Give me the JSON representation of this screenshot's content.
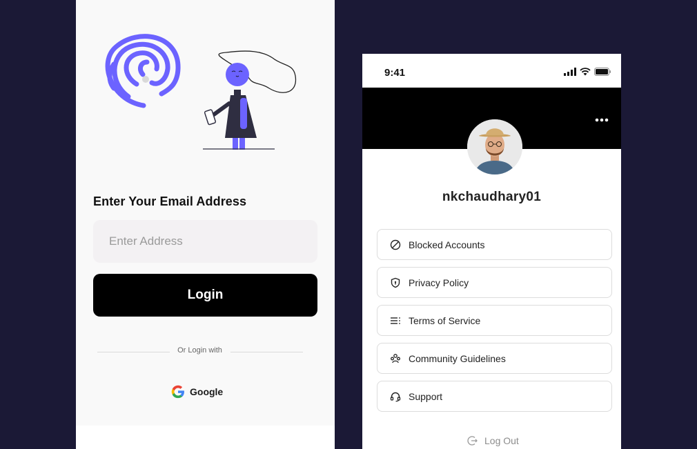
{
  "login": {
    "heading": "Enter Your Email Address",
    "address_placeholder": "Enter Address",
    "login_label": "Login",
    "divider_text": "Or Login with",
    "google_label": "Google"
  },
  "profile": {
    "status_time": "9:41",
    "username": "nkchaudhary01",
    "menu": [
      {
        "label": "Blocked Accounts",
        "icon": "blocked-icon"
      },
      {
        "label": "Privacy Policy",
        "icon": "shield-icon"
      },
      {
        "label": "Terms of Service",
        "icon": "list-icon"
      },
      {
        "label": "Community Guidelines",
        "icon": "community-icon"
      },
      {
        "label": "Support",
        "icon": "headset-icon"
      }
    ],
    "logout_label": "Log Out"
  },
  "colors": {
    "background": "#1b1936",
    "accent": "#6c63ff",
    "button": "#000000"
  }
}
